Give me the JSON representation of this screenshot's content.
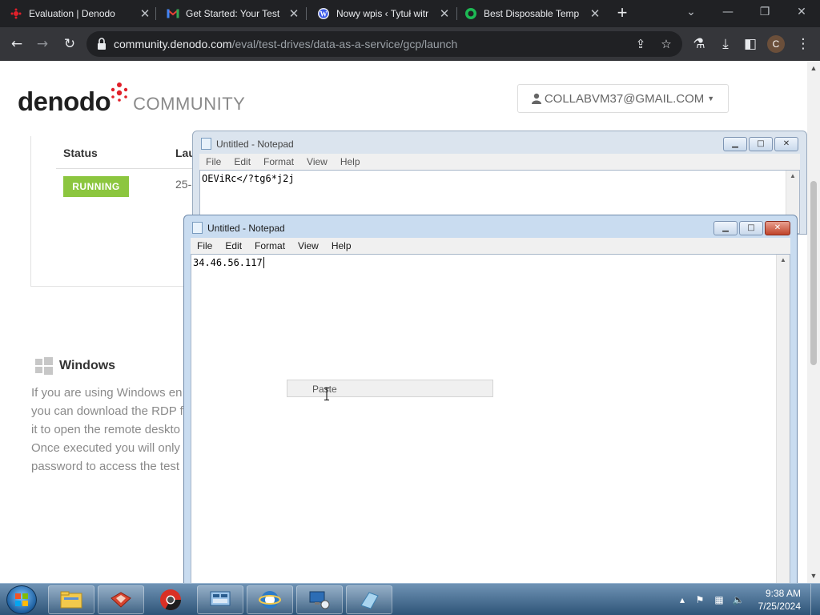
{
  "browser": {
    "tabs": [
      {
        "title": "Evaluation | Denodo",
        "icon": "denodo-icon"
      },
      {
        "title": "Get Started: Your Test",
        "icon": "gmail-icon"
      },
      {
        "title": "Nowy wpis ‹ Tytuł witr",
        "icon": "wordpress-icon"
      },
      {
        "title": "Best Disposable Temp",
        "icon": "green-circle-icon"
      }
    ],
    "url_host": "community.denodo.com",
    "url_path": "/eval/test-drives/data-as-a-service/gcp/launch",
    "profile_initial": "C"
  },
  "page": {
    "brand": "denodo",
    "brand_suffix": "COMMUNITY",
    "user_email": "COLLABVM37@GMAIL.COM",
    "status_header": "Status",
    "launch_header": "Lau",
    "status_badge": "RUNNING",
    "launch_date": "25-",
    "windows_title": "Windows",
    "windows_lines": [
      "If you are using Windows en",
      "you can download the RDP f",
      "it to open the remote deskto",
      "Once executed you will only",
      "password to access the test"
    ]
  },
  "notepad_back": {
    "title": "Untitled - Notepad",
    "menu": [
      "File",
      "Edit",
      "Format",
      "View",
      "Help"
    ],
    "text": "OEViRc</?tg6*j2j"
  },
  "notepad_front": {
    "title": "Untitled - Notepad",
    "menu": [
      "File",
      "Edit",
      "Format",
      "View",
      "Help"
    ],
    "text": "34.46.56.117"
  },
  "context_menu": {
    "item": "Paste"
  },
  "taskbar": {
    "apps": [
      "explorer-icon",
      "toolbox-icon",
      "chrome-icon",
      "control-panel-icon",
      "ie-icon",
      "remote-desktop-icon",
      "notepad-icon"
    ],
    "time": "9:38 AM",
    "date": "7/25/2024"
  },
  "colors": {
    "badge": "#8cc63f",
    "denodo_red": "#e0202a",
    "chrome_dark": "#202124"
  }
}
